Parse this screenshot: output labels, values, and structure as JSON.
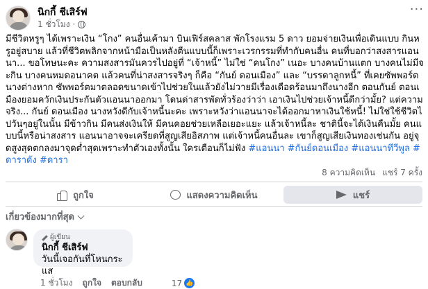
{
  "post": {
    "author": "นิกกี้ ชีเสิร์ฟ",
    "time": "1 ชั่วโมง",
    "body": "มีชีวิตหรูๆ ได้เพราะเงิน “โกง” คนอื่นเค้ามา บินเฟิร์สคลาส พักโรงแรม 5 ดาว ยอมจ่ายเงินเพื่อเดินแบบ กินหรูอยู่สบาย แล้วที่ชีวิตพลิกจากหน้ามือเป็นหลังตีนแบบนี้ก็เพราะเวรกรรมที่ทำกับคนอื่น คนที่บอกว่าสงสารแอนนา... ขอโทษนะคะ ความสงสารมันควรไปอยู่ที่ “เจ้าหนี้” ไม่ใช่ “คนโกง” เนอะ บางคนบ้านแตก บางคนไม่มีจะกิน บางคนหมดอนาคต แล้วคนที่น่าสงสารจริงๆ ก็คือ “กันย์ ดอนเมือง” และ “บรรดาลูกหนี้” ที่เคยซัพพอร์ตนางต่างหาก ซัพพอร์ตมาตลอดขนาดเข้าไปช่วยในแล้วยังไม่วายมีเรื่องเดือดร้อนมาถึงนางอีก ตอนกันย์ ตอนเมืองยอมควักเงินประกันตัวแอนนาออกมา โดนด่าสารพัดทั่วร้องว่าว่า เอาเงินไปช่วยเจ้าหนี้ดีกว่ามั้ย? แต่ความจริง... กันย์ ดอนเมือง นางหวังดีกับเจ้าหนี้นะคะ เพราะหวังว่าแอนนาจะได้ออกมาหาเงินใช้หนี้! ไม่ใช่ใช้ชีวิตไปวันๆอยู่ในนั้น มีข้าวกิน มีคนส่งเงินให้ มีคนคอยช่วยเหลือเยอะแยะ แล้วเจ้าหนี้ละ ชาตินี้จะได้เงินคืนมั้ย คนแบบนี้หรือน่าสงสาร แอนนาอาจจะเครียดที่สูญเสียอิสภาพ แต่เจ้าหนี้คนอื่นละ เขาก็สูญเสียเงินทองเช่นกัน อยู่จุดสูงสุดตกลงมาจุดต่ำสุดเพราะทำตัวเองทั้งนั้น ใครเตือนก็ไม่ฟัง",
    "hashtags": "#แอนนา #กันย์ดอนเมือง #แอนนาทีวีพูล #ดาราดัง #ดารา",
    "comments_count": "8 ความคิดเห็น",
    "shares_count": "แชร์ 7 ครั้ง"
  },
  "actions": {
    "like": "ถูกใจ",
    "comment": "แสดงความคิดเห็น",
    "share": "แชร์"
  },
  "sort_label": "เกี่ยวข้องมากที่สุด",
  "comment": {
    "badge": "ผู้เขียน",
    "author": "นิกกี้ ชีเสิร์ฟ",
    "text": "วันนี้เจอกันที่โหนกระแส",
    "time": "1 ชั่วโมง",
    "like": "ถูกใจ",
    "reply": "ตอบกลับ",
    "reactions": "17"
  },
  "colors": {
    "hashtag": "#216fdb",
    "muted": "#65676b",
    "like_badge": "#1877f2"
  }
}
